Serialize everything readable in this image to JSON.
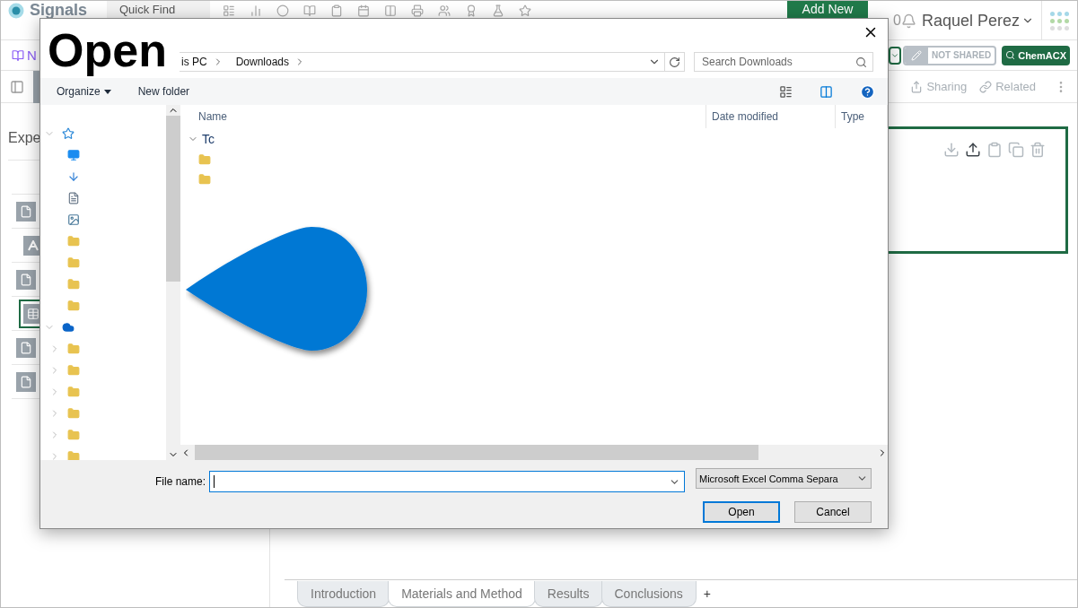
{
  "app": {
    "logo": "Signals",
    "quick_find": "Quick Find",
    "add_new": "Add New",
    "notifications": "0",
    "user": "Raquel Perez",
    "notebook_label": "N",
    "sharing_status": "NOT SHARED",
    "search_button": "ChemACX",
    "actions": [
      "Sharing",
      "Related"
    ],
    "sidebar": {
      "title": "Expe",
      "items": [
        {
          "kind": "document",
          "selected": false
        },
        {
          "kind": "text",
          "selected": false
        },
        {
          "kind": "document",
          "selected": false
        },
        {
          "kind": "table",
          "selected": true
        },
        {
          "kind": "document",
          "selected": false
        },
        {
          "kind": "document",
          "selected": false
        }
      ]
    },
    "card": {
      "tools": [
        {
          "kind": "download",
          "disabled": true
        },
        {
          "kind": "upload",
          "disabled": false
        },
        {
          "kind": "paste",
          "disabled": true
        },
        {
          "kind": "copy",
          "disabled": true
        },
        {
          "kind": "delete",
          "disabled": true
        }
      ]
    },
    "tabs": [
      {
        "label": "Introduction",
        "selected": false
      },
      {
        "label": "Materials and Method",
        "selected": true
      },
      {
        "label": "Results",
        "selected": false
      },
      {
        "label": "Conclusions",
        "selected": false
      }
    ],
    "add_tab": "+"
  },
  "dialog": {
    "title": "Open",
    "breadcrumb": [
      "is PC",
      "Downloads"
    ],
    "search": {
      "placeholder": "Search Downloads"
    },
    "toolbar": [
      "Organize",
      "New folder"
    ],
    "nav": [
      {
        "kind": "quick-access",
        "expanded": true,
        "children": [
          {
            "kind": "desktop"
          },
          {
            "kind": "downloads"
          },
          {
            "kind": "documents"
          },
          {
            "kind": "pictures"
          },
          {
            "kind": "folder"
          },
          {
            "kind": "folder"
          },
          {
            "kind": "folder"
          },
          {
            "kind": "folder"
          }
        ]
      },
      {
        "kind": "cloud",
        "expanded": true,
        "children": [
          {
            "kind": "folder",
            "expanded": false
          },
          {
            "kind": "folder",
            "expanded": false
          },
          {
            "kind": "folder",
            "expanded": false
          },
          {
            "kind": "folder",
            "expanded": false
          },
          {
            "kind": "folder",
            "expanded": false
          },
          {
            "kind": "folder",
            "expanded": false
          }
        ]
      }
    ],
    "columns": [
      "Name",
      "Date modified",
      "Type"
    ],
    "groups": [
      {
        "label": "Tc",
        "expanded": true,
        "files": [
          {
            "kind": "folder"
          },
          {
            "kind": "folder"
          }
        ]
      }
    ],
    "file_name_label": "File name:",
    "file_type": "Microsoft Excel Comma Separa",
    "buttons": [
      {
        "label": "Open",
        "default": true
      },
      {
        "label": "Cancel",
        "default": false
      }
    ]
  }
}
